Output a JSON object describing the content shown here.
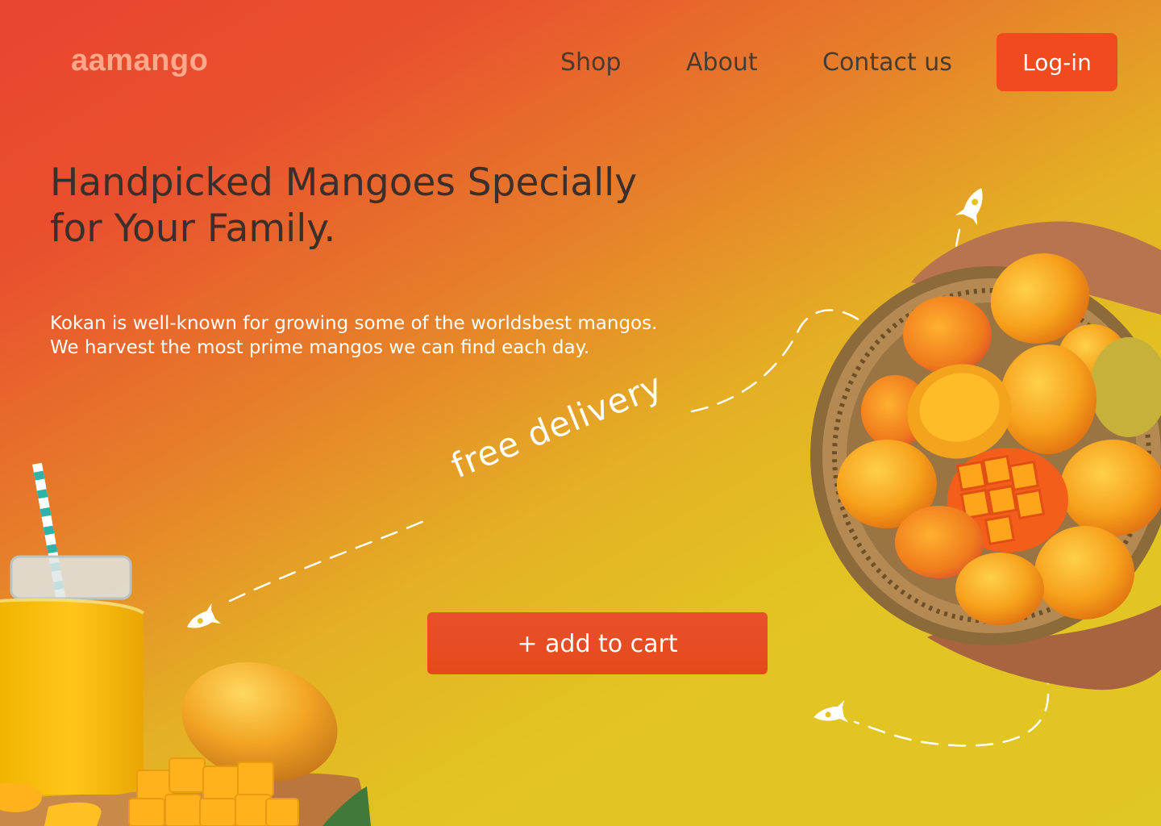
{
  "brand": {
    "name": "aamango"
  },
  "nav": {
    "items": [
      {
        "label": "Shop"
      },
      {
        "label": "About"
      },
      {
        "label": "Contact us"
      }
    ],
    "login_label": "Log-in"
  },
  "hero": {
    "headline_line1": "Handpicked Mangoes Specially",
    "headline_line2": "for Your Family.",
    "description": "Kokan is well-known for growing some of the worldsbest mangos. We harvest the most prime mangos we can find each day.",
    "badge": "free delivery",
    "cart_label": "+ add to cart"
  },
  "colors": {
    "accent": "#f04a1e",
    "headline": "#3a2f2a",
    "background_top": "#e8452f",
    "background_bottom": "#e1c723"
  },
  "icons": [
    "rocket-icon"
  ]
}
